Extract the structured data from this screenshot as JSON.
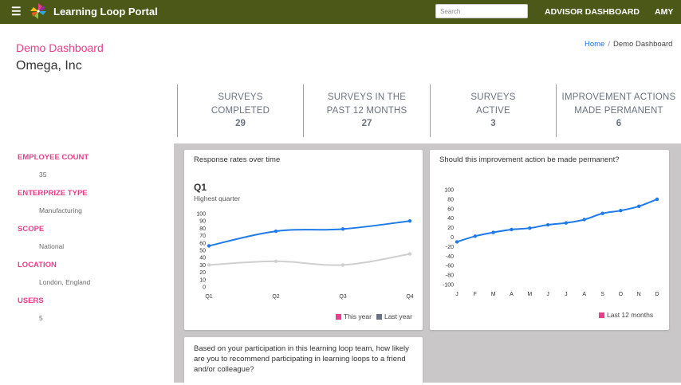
{
  "header": {
    "app_title": "Learning Loop Portal",
    "menu_icon": "hamburger-icon",
    "logo_icon": "pinwheel-logo-icon",
    "search_placeholder": "Search",
    "advisor_link": "ADVISOR DASHBOARD",
    "user": "AMY"
  },
  "page": {
    "subtitle": "Demo Dashboard",
    "title": "Omega, Inc"
  },
  "breadcrumb": {
    "home": "Home",
    "separator": "/",
    "current": "Demo Dashboard"
  },
  "stats": [
    {
      "label_line1": "SURVEYS",
      "label_line2": "COMPLETED",
      "value": "29"
    },
    {
      "label_line1": "SURVEYS IN THE",
      "label_line2": "PAST 12 MONTHS",
      "value": "27"
    },
    {
      "label_line1": "SURVEYS",
      "label_line2": "ACTIVE",
      "value": "3"
    },
    {
      "label_line1": "IMPROVEMENT ACTIONS",
      "label_line2": "MADE PERMANENT",
      "value": "6"
    }
  ],
  "sidebar": [
    {
      "label": "EMPLOYEE COUNT",
      "value": "35"
    },
    {
      "label": "ENTERPRIZE TYPE",
      "value": "Manufacturing"
    },
    {
      "label": "SCOPE",
      "value": "National"
    },
    {
      "label": "LOCATION",
      "value": "London, England"
    },
    {
      "label": "USERS",
      "value": "5"
    }
  ],
  "colors": {
    "topbar": "#4b5818",
    "accent_pink": "#e83e8c",
    "line_blue": "#1e7ae8",
    "line_gray": "#cfcfcf",
    "legend_gray": "#6b7280"
  },
  "cards": {
    "response_rates": {
      "title": "Response rates over time",
      "highlight": "Q1",
      "highlight_sub": "Highest quarter",
      "legend_this_year": "This year",
      "legend_last_year": "Last year"
    },
    "permanent": {
      "title": "Should this improvement action be made permanent?",
      "legend": "Last 12 months"
    },
    "recommend": {
      "text": "Based on your participation in this learning loop team, how likely are you to recommend participating in learning loops to a friend and/or colleague?"
    }
  },
  "chart_data": [
    {
      "type": "line",
      "title": "Response rates over time",
      "categories": [
        "Q1",
        "Q2",
        "Q3",
        "Q4"
      ],
      "y_ticks": [
        0,
        10,
        20,
        30,
        40,
        50,
        60,
        70,
        80,
        90,
        100
      ],
      "ylim": [
        0,
        100
      ],
      "grid": false,
      "legend_position": "bottom-right",
      "series": [
        {
          "name": "This year",
          "values": [
            56,
            76,
            79,
            90
          ],
          "color": "#1e7ae8",
          "markers": true
        },
        {
          "name": "Last year",
          "values": [
            30,
            35,
            30,
            45
          ],
          "color": "#cfcfcf",
          "markers": true
        }
      ]
    },
    {
      "type": "line",
      "title": "Should this improvement action be made permanent?",
      "categories": [
        "J",
        "F",
        "M",
        "A",
        "M",
        "J",
        "J",
        "A",
        "S",
        "O",
        "N",
        "D"
      ],
      "y_ticks": [
        -100,
        -80,
        -60,
        -40,
        -20,
        0,
        20,
        40,
        60,
        80,
        100
      ],
      "ylim": [
        -100,
        100
      ],
      "grid": false,
      "legend_position": "bottom-right",
      "series": [
        {
          "name": "Last 12 months",
          "values": [
            -10,
            2,
            10,
            16,
            19,
            26,
            30,
            37,
            50,
            56,
            65,
            80
          ],
          "color": "#1e7ae8",
          "markers": true
        }
      ]
    }
  ]
}
